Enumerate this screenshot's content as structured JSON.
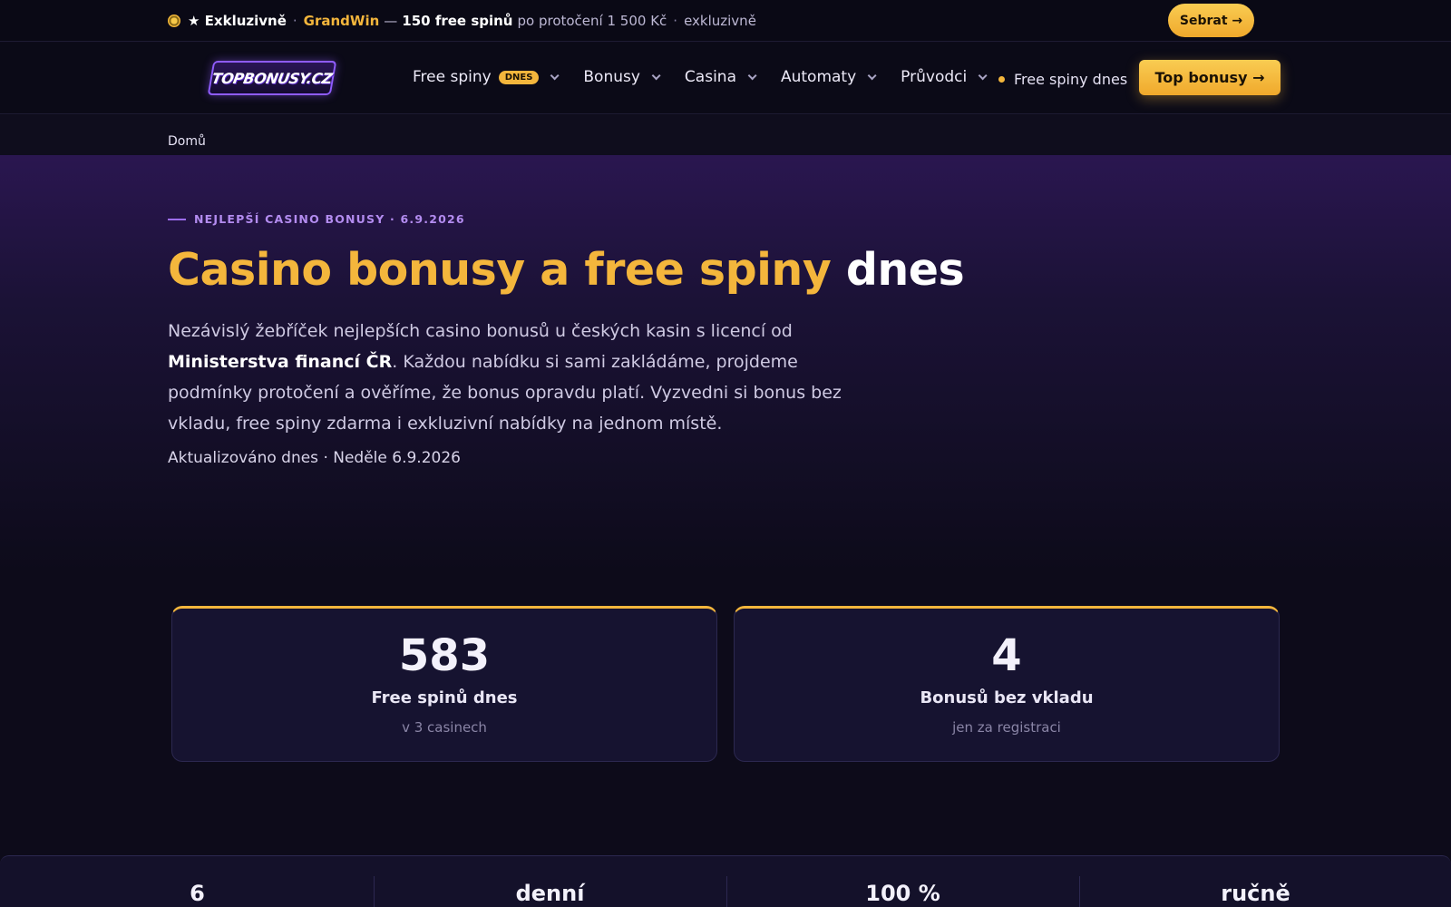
{
  "promo": {
    "exclusive": "★ Exkluzivně",
    "separator": "·",
    "brand": "GrandWin",
    "dash": "—",
    "spins": "150 free spinů",
    "condition": "po protočení 1 500 Kč",
    "tail": "exkluzivně",
    "claim_label": "Sebrat →",
    "icon": "coin-icon"
  },
  "nav": {
    "logo_text": "TOPBONUSY.CZ",
    "items": [
      {
        "label": "Free spiny",
        "badge": "DNES"
      },
      {
        "label": "Bonusy"
      },
      {
        "label": "Casina"
      },
      {
        "label": "Automaty"
      },
      {
        "label": "Průvodci"
      }
    ],
    "today_link": "Free spiny dnes",
    "cta_label": "Top bonusy →"
  },
  "breadcrumb": {
    "home": "Domů"
  },
  "hero": {
    "eyebrow": "NEJLEPŠÍ CASINO BONUSY · 6.9.2026",
    "title_accent": "Casino bonusy a free spiny",
    "title_plain": "dnes",
    "desc_1": "Nezávislý žebříček nejlepších casino bonusů u českých kasin s licencí od",
    "desc_bold": "Ministerstva financí ČR",
    "desc_2": ". Každou nabídku si sami zakládáme, projdeme podmínky protočení a ověříme, že bonus opravdu platí. Vyzvedni si bonus bez vkladu, free spiny zdarma i exkluzivní nabídky na jednom místě.",
    "updated": "Aktualizováno dnes · Neděle 6.9.2026"
  },
  "cards": [
    {
      "value": "583",
      "label": "Free spinů dnes",
      "sub": "v 3 casinech"
    },
    {
      "value": "4",
      "label": "Bonusů bez vkladu",
      "sub": "jen za registraci"
    }
  ],
  "stats": [
    "6",
    "denní",
    "100 %",
    "ručně"
  ],
  "colors": {
    "accent": "#f4b63c",
    "purple": "#9c6df0",
    "background": "#0d0b1a"
  }
}
